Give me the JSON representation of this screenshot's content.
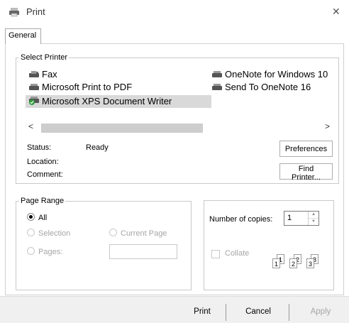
{
  "window": {
    "title": "Print",
    "close_icon": "close-icon",
    "printer_icon": "printer-icon"
  },
  "tabs": [
    {
      "label": "General",
      "active": true
    }
  ],
  "select_printer": {
    "legend": "Select Printer",
    "printers": [
      {
        "name": "Fax",
        "icon": "fax-icon",
        "selected": false
      },
      {
        "name": "Microsoft Print to PDF",
        "icon": "printer-icon",
        "selected": false
      },
      {
        "name": "Microsoft XPS Document Writer",
        "icon": "printer-default-icon",
        "selected": true
      },
      {
        "name": "OneNote for Windows 10",
        "icon": "printer-icon",
        "selected": false
      },
      {
        "name": "Send To OneNote 16",
        "icon": "printer-icon",
        "selected": false
      }
    ],
    "scroll_left": "<",
    "scroll_right": ">",
    "status_label": "Status:",
    "status_value": "Ready",
    "location_label": "Location:",
    "location_value": "",
    "comment_label": "Comment:",
    "comment_value": "",
    "preferences_button": "Preferences",
    "find_printer_button": "Find Printer..."
  },
  "page_range": {
    "legend": "Page Range",
    "all_label": "All",
    "selection_label": "Selection",
    "current_page_label": "Current Page",
    "pages_label": "Pages:",
    "pages_value": "",
    "selected_option": "All"
  },
  "copies": {
    "number_label": "Number of copies:",
    "number_value": "1",
    "collate_label": "Collate",
    "collate_checked": false,
    "collate_pages": [
      "1",
      "1",
      "2",
      "2",
      "3",
      "3"
    ]
  },
  "footer": {
    "print_button": "Print",
    "cancel_button": "Cancel",
    "apply_button": "Apply"
  },
  "colors": {
    "selected_row": "#d9d9d9",
    "disabled_text": "#a6a6a6",
    "footer_bg": "#f0f0f0"
  }
}
